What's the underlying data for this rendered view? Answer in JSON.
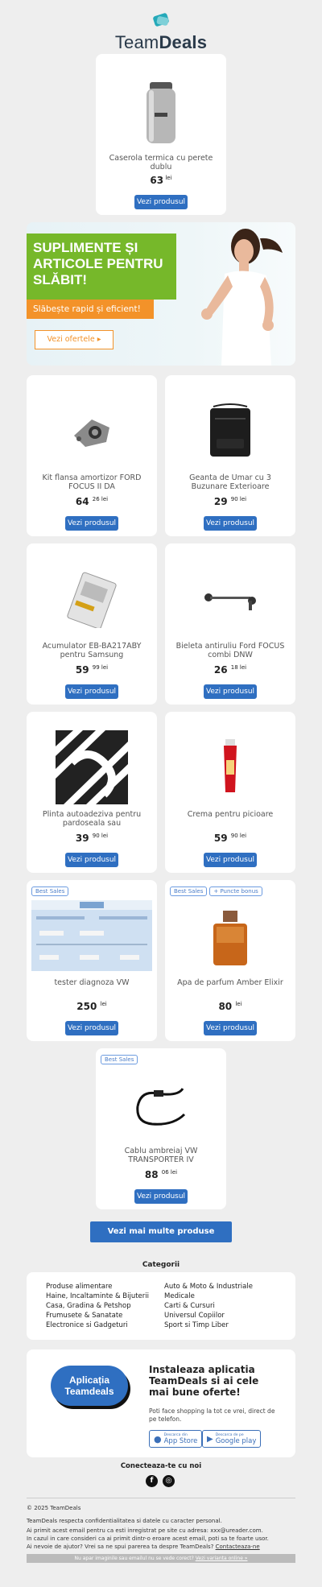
{
  "brand": {
    "logo_light": "Team",
    "logo_bold": "Deals"
  },
  "featured": {
    "name": "Caserola termica cu perete dublu",
    "price_int": "63",
    "price_dec": "",
    "currency": "lei",
    "button": "Vezi produsul"
  },
  "banner": {
    "headline": "SUPLIMENTE ȘI ARTICOLE PENTRU SLĂBIT!",
    "subline": "Slăbește rapid și eficient!",
    "cta": "Vezi ofertele ▸"
  },
  "products": [
    {
      "name": "Kit flansa amortizor FORD FOCUS II DA",
      "price_int": "64",
      "price_dec": "26",
      "currency": "lei",
      "button": "Vezi produsul",
      "badges": []
    },
    {
      "name": "Geanta de Umar cu 3 Buzunare Exterioare",
      "price_int": "29",
      "price_dec": "90",
      "currency": "lei",
      "button": "Vezi produsul",
      "badges": []
    },
    {
      "name": "Acumulator EB-BA217ABY pentru Samsung",
      "price_int": "59",
      "price_dec": "99",
      "currency": "lei",
      "button": "Vezi produsul",
      "badges": []
    },
    {
      "name": "Bieleta antiruliu Ford FOCUS combi DNW",
      "price_int": "26",
      "price_dec": "18",
      "currency": "lei",
      "button": "Vezi produsul",
      "badges": []
    },
    {
      "name": "Plinta autoadeziva pentru pardoseala sau",
      "price_int": "39",
      "price_dec": "90",
      "currency": "lei",
      "button": "Vezi produsul",
      "badges": []
    },
    {
      "name": "Crema pentru picioare",
      "price_int": "59",
      "price_dec": "90",
      "currency": "lei",
      "button": "Vezi produsul",
      "badges": []
    },
    {
      "name": "tester diagnoza VW",
      "price_int": "250",
      "price_dec": "",
      "currency": "lei",
      "button": "Vezi produsul",
      "badges": [
        "Best Sales"
      ]
    },
    {
      "name": "Apa de parfum Amber Elixir",
      "price_int": "80",
      "price_dec": "",
      "currency": "lei",
      "button": "Vezi produsul",
      "badges": [
        "Best Sales",
        "+ Puncte bonus"
      ]
    },
    {
      "name": "Cablu ambreiaj VW TRANSPORTER IV",
      "price_int": "88",
      "price_dec": "06",
      "currency": "lei",
      "button": "Vezi produsul",
      "badges": [
        "Best Sales"
      ]
    }
  ],
  "more_button": "Vezi mai multe produse",
  "categories": {
    "title": "Categorii",
    "col1": [
      "Produse alimentare",
      "Haine, Incaltaminte & Bijuterii",
      "Casa, Gradina & Petshop",
      "Frumusete & Sanatate",
      "Electronice si Gadgeturi"
    ],
    "col2": [
      "Auto & Moto & Industriale",
      "Medicale",
      "Carti & Cursuri",
      "Universul Copiilor",
      "Sport si Timp Liber"
    ]
  },
  "app": {
    "blob_line1": "Aplicația",
    "blob_line2": "Teamdeals",
    "title": "Instaleaza aplicatia TeamDeals si ai cele mai bune oferte!",
    "subtitle": "Poti face shopping la tot ce vrei, direct de pe telefon.",
    "appstore_small": "Descarca din",
    "appstore": "App Store",
    "googleplay_small": "Descarca de pe",
    "googleplay": "Google play"
  },
  "social": {
    "title": "Conecteaza-te cu noi",
    "facebook": "f",
    "instagram": "◎"
  },
  "footer": {
    "copyright": "© 2025 TeamDeals",
    "privacy": "TeamDeals respecta confidentialitatea si datele cu caracter personal.",
    "registered": "Ai primit acest email pentru ca esti inregistrat pe site cu adresa: xxx@ureader.com.",
    "error": "In cazul in care consideri ca ai primit dintr-o eroare acest email, poti sa te foarte usor.",
    "help": "Ai nevoie de ajutor? Vrei sa ne spui parerea ta despre TeamDeals?",
    "contact_link": "Contacteaza-ne",
    "bar": "Nu apar imaginile sau emailul nu se vede corect?",
    "bar_link": "Vezi varianta online »"
  }
}
